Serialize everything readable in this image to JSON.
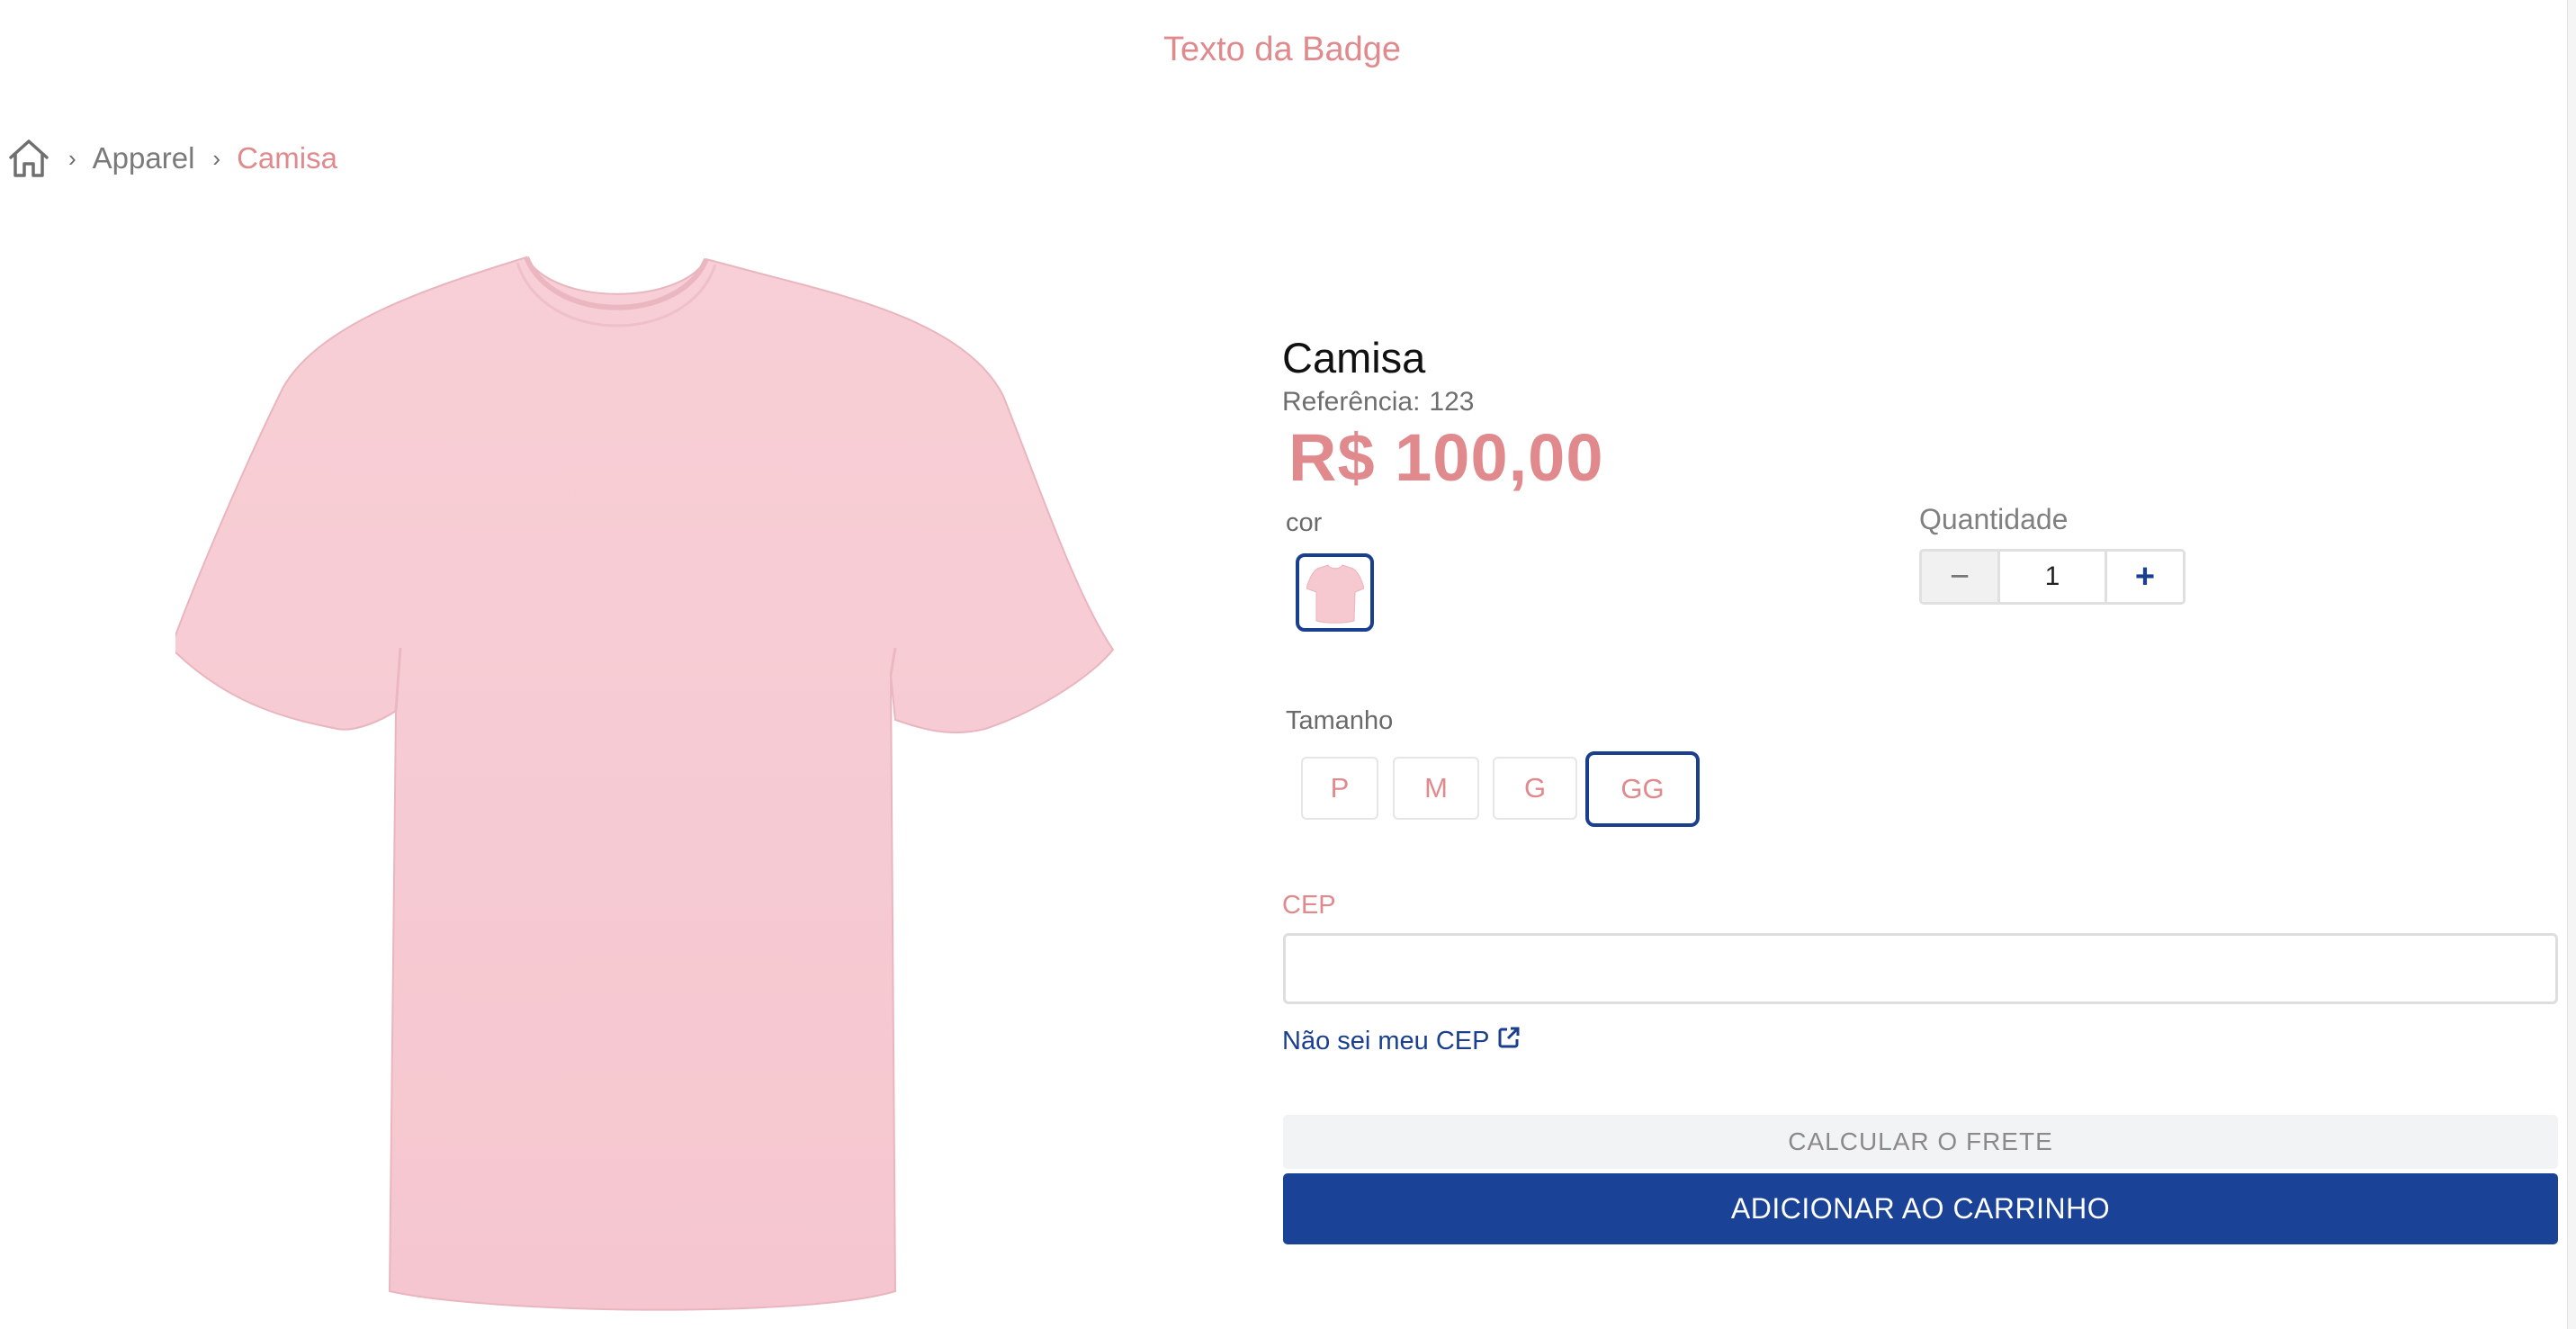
{
  "badge": {
    "text": "Texto da Badge"
  },
  "breadcrumb": {
    "home_icon": "home-icon",
    "items": [
      {
        "label": "Apparel"
      },
      {
        "label": "Camisa"
      }
    ]
  },
  "product": {
    "name": "Camisa",
    "reference_label": "Referência:",
    "reference_value": "123",
    "price": "R$ 100,00",
    "image": "pink-tshirt"
  },
  "variants": {
    "color_label": "cor",
    "size_label": "Tamanho",
    "sizes": [
      "P",
      "M",
      "G",
      "GG"
    ],
    "selected_size": "GG"
  },
  "quantity": {
    "label": "Quantidade",
    "value": "1",
    "minus": "−",
    "plus": "+"
  },
  "shipping": {
    "cep_label": "CEP",
    "cep_value": "",
    "unknown_cep_link": "Não sei meu CEP",
    "calculate_button": "CALCULAR O FRETE"
  },
  "cart": {
    "add_button": "ADICIONAR AO CARRINHO"
  },
  "colors": {
    "accent_pink": "#e08a8d",
    "primary_blue": "#1a4296",
    "selected_border": "#1b3f8f"
  }
}
